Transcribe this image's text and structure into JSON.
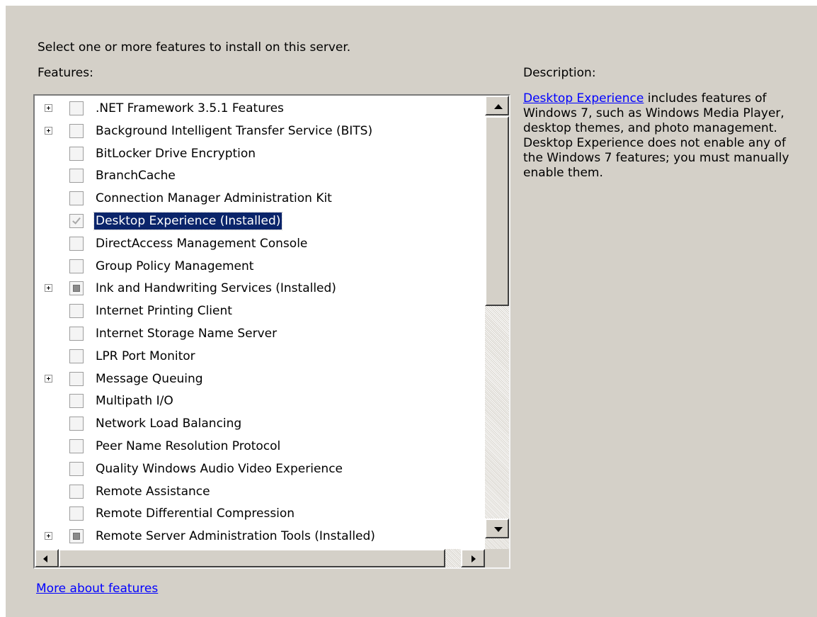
{
  "page": {
    "instruction": "Select one or more features to install on this server.",
    "features_label": "Features:",
    "description_label": "Description:",
    "more_link": "More about features"
  },
  "description": {
    "link_text": "Desktop Experience",
    "body": " includes features of Windows 7, such as Windows Media Player, desktop themes, and photo management. Desktop Experience does not enable any of the Windows 7 features; you must manually enable them."
  },
  "features": [
    {
      "label": ".NET Framework 3.5.1 Features",
      "expandable": true,
      "state": "unchecked",
      "selected": false
    },
    {
      "label": "Background Intelligent Transfer Service (BITS)",
      "expandable": true,
      "state": "unchecked",
      "selected": false
    },
    {
      "label": "BitLocker Drive Encryption",
      "expandable": false,
      "state": "unchecked",
      "selected": false
    },
    {
      "label": "BranchCache",
      "expandable": false,
      "state": "unchecked",
      "selected": false
    },
    {
      "label": "Connection Manager Administration Kit",
      "expandable": false,
      "state": "unchecked",
      "selected": false
    },
    {
      "label": "Desktop Experience  (Installed)",
      "expandable": false,
      "state": "checked",
      "selected": true
    },
    {
      "label": "DirectAccess Management Console",
      "expandable": false,
      "state": "unchecked",
      "selected": false
    },
    {
      "label": "Group Policy Management",
      "expandable": false,
      "state": "unchecked",
      "selected": false
    },
    {
      "label": "Ink and Handwriting Services  (Installed)",
      "expandable": true,
      "state": "partial",
      "selected": false
    },
    {
      "label": "Internet Printing Client",
      "expandable": false,
      "state": "unchecked",
      "selected": false
    },
    {
      "label": "Internet Storage Name Server",
      "expandable": false,
      "state": "unchecked",
      "selected": false
    },
    {
      "label": "LPR Port Monitor",
      "expandable": false,
      "state": "unchecked",
      "selected": false
    },
    {
      "label": "Message Queuing",
      "expandable": true,
      "state": "unchecked",
      "selected": false
    },
    {
      "label": "Multipath I/O",
      "expandable": false,
      "state": "unchecked",
      "selected": false
    },
    {
      "label": "Network Load Balancing",
      "expandable": false,
      "state": "unchecked",
      "selected": false
    },
    {
      "label": "Peer Name Resolution Protocol",
      "expandable": false,
      "state": "unchecked",
      "selected": false
    },
    {
      "label": "Quality Windows Audio Video Experience",
      "expandable": false,
      "state": "unchecked",
      "selected": false
    },
    {
      "label": "Remote Assistance",
      "expandable": false,
      "state": "unchecked",
      "selected": false
    },
    {
      "label": "Remote Differential Compression",
      "expandable": false,
      "state": "unchecked",
      "selected": false
    },
    {
      "label": "Remote Server Administration Tools  (Installed)",
      "expandable": true,
      "state": "partial",
      "selected": false
    }
  ],
  "icons": {
    "expand": "plus-box-icon",
    "scroll_up": "arrow-up-icon",
    "scroll_down": "arrow-down-icon",
    "scroll_left": "arrow-left-icon",
    "scroll_right": "arrow-right-icon"
  },
  "colors": {
    "dialog_background": "#d4d0c8",
    "selection": "#0a246a",
    "link": "#0000ff"
  }
}
